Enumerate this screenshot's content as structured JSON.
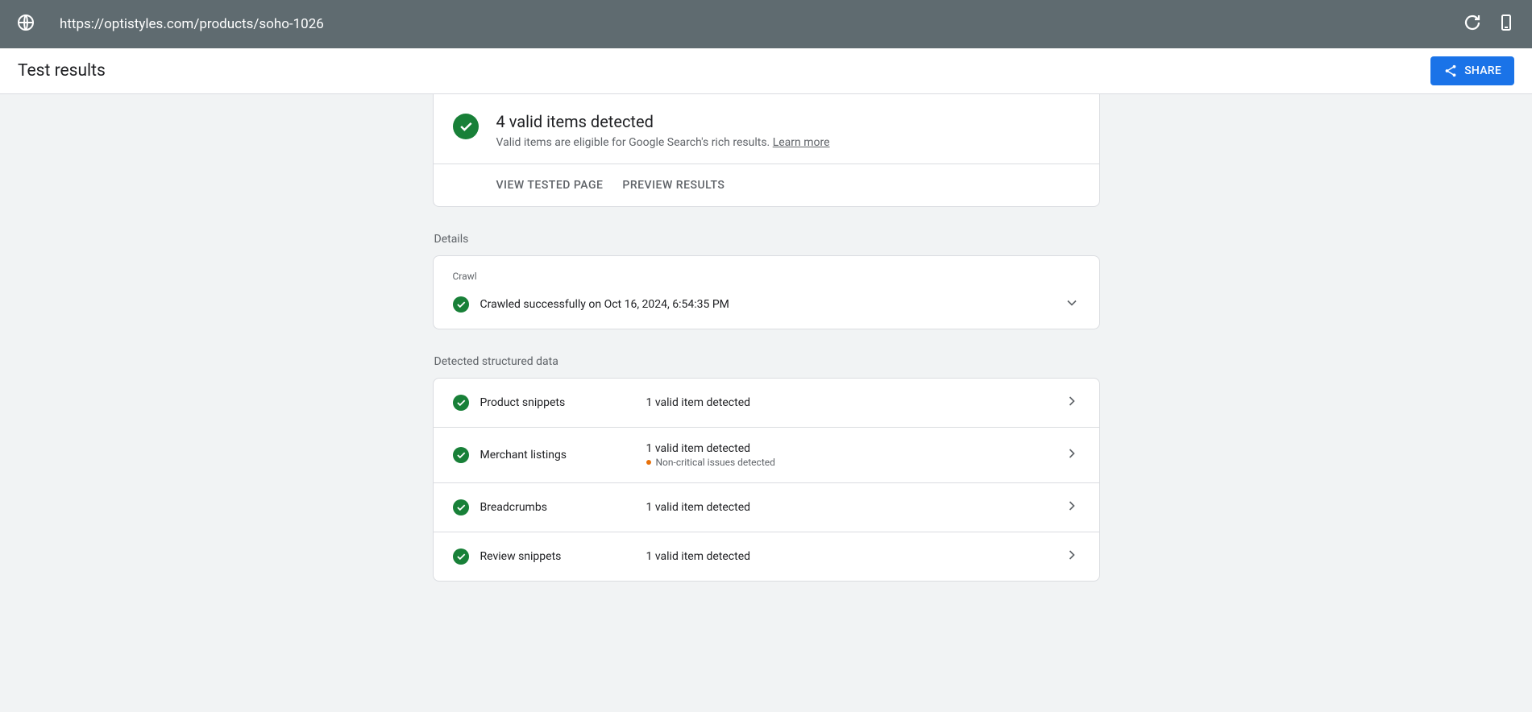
{
  "topbar": {
    "url": "https://optistyles.com/products/soho-1026"
  },
  "header": {
    "title": "Test results",
    "share_label": "SHARE"
  },
  "summary": {
    "title": "4 valid items detected",
    "subtitle_prefix": "Valid items are eligible for Google Search's rich results. ",
    "learn_more": "Learn more",
    "view_tested": "VIEW TESTED PAGE",
    "preview_results": "PREVIEW RESULTS"
  },
  "sections": {
    "details_label": "Details",
    "crawl_label": "Crawl",
    "crawl_text": "Crawled successfully on Oct 16, 2024, 6:54:35 PM",
    "structured_label": "Detected structured data"
  },
  "rows": [
    {
      "name": "Product snippets",
      "status": "1 valid item detected",
      "issue": null
    },
    {
      "name": "Merchant listings",
      "status": "1 valid item detected",
      "issue": "Non-critical issues detected"
    },
    {
      "name": "Breadcrumbs",
      "status": "1 valid item detected",
      "issue": null
    },
    {
      "name": "Review snippets",
      "status": "1 valid item detected",
      "issue": null
    }
  ]
}
